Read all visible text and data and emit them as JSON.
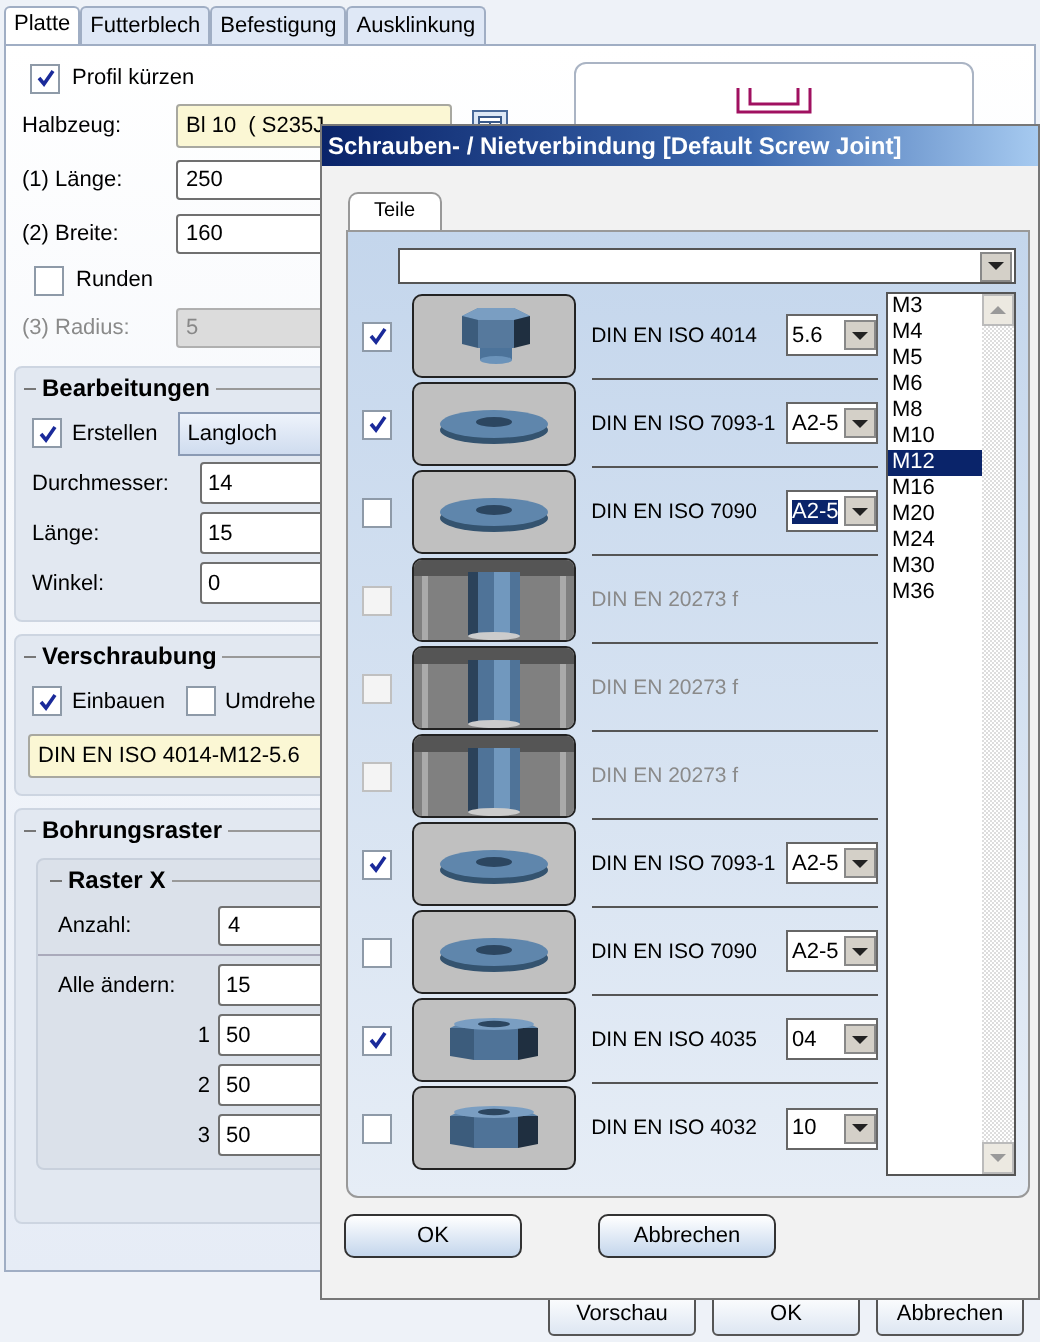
{
  "tabs": [
    {
      "label": "Platte",
      "selected": true
    },
    {
      "label": "Futterblech",
      "selected": false
    },
    {
      "label": "Befestigung",
      "selected": false
    },
    {
      "label": "Ausklinkung",
      "selected": false
    }
  ],
  "profil_kuerzen": {
    "label": "Profil kürzen",
    "checked": true
  },
  "halbzeug": {
    "label": "Halbzeug:",
    "value": "Bl 10  ( S235J"
  },
  "dims": [
    {
      "label": "(1) Länge:",
      "value": "250"
    },
    {
      "label": "(2) Breite:",
      "value": "160"
    }
  ],
  "runden": {
    "label": "Runden",
    "checked": false
  },
  "radius": {
    "label": "(3) Radius:",
    "value": "5",
    "disabled": true
  },
  "bearbeitungen": {
    "title": "Bearbeitungen",
    "erstellen": {
      "label": "Erstellen",
      "checked": true
    },
    "type": "Langloch",
    "fields": [
      {
        "label": "Durchmesser:",
        "value": "14"
      },
      {
        "label": "Länge:",
        "value": "15"
      },
      {
        "label": "Winkel:",
        "value": "0"
      }
    ]
  },
  "verschraubung": {
    "title": "Verschraubung",
    "checks": [
      {
        "label": "Einbauen",
        "checked": true
      },
      {
        "label": "Umdrehe",
        "checked": false
      }
    ],
    "description": "DIN EN ISO 4014-M12-5.6"
  },
  "bohrungsraster": {
    "title": "Bohrungsraster",
    "raster_x": {
      "title": "Raster X",
      "anzahl": {
        "label": "Anzahl:",
        "value": "4"
      },
      "alle": {
        "label": "Alle ändern:",
        "value": "15"
      },
      "items": [
        {
          "label": "1",
          "value": "50"
        },
        {
          "label": "2",
          "value": "50"
        },
        {
          "label": "3",
          "value": "50"
        }
      ]
    }
  },
  "buttons": [
    "Vorschau",
    "OK",
    "Abbrechen"
  ],
  "dialog": {
    "title": "Schrauben- / Nietverbindung [Default Screw Joint]",
    "tabs": [
      {
        "label": "Teile",
        "selected": true
      }
    ],
    "parts": [
      {
        "kind": "bolt",
        "checked": true,
        "disabled": false,
        "label": "DIN EN ISO 4014",
        "grade": "5.6",
        "grade_highlighted": false
      },
      {
        "kind": "washer",
        "checked": true,
        "disabled": false,
        "label": "DIN EN ISO 7093-1",
        "grade": "A2-5",
        "grade_highlighted": false
      },
      {
        "kind": "washer",
        "checked": false,
        "disabled": false,
        "label": "DIN EN ISO 7090",
        "grade": "A2-5",
        "grade_highlighted": true
      },
      {
        "kind": "hole",
        "checked": false,
        "disabled": true,
        "label": "DIN EN 20273 f"
      },
      {
        "kind": "hole",
        "checked": false,
        "disabled": true,
        "label": "DIN EN 20273 f"
      },
      {
        "kind": "hole",
        "checked": false,
        "disabled": true,
        "label": "DIN EN 20273 f"
      },
      {
        "kind": "washer",
        "checked": true,
        "disabled": false,
        "label": "DIN EN ISO 7093-1",
        "grade": "A2-5",
        "grade_highlighted": false
      },
      {
        "kind": "washer",
        "checked": false,
        "disabled": false,
        "label": "DIN EN ISO 7090",
        "grade": "A2-5",
        "grade_highlighted": false
      },
      {
        "kind": "nut",
        "checked": true,
        "disabled": false,
        "label": "DIN EN ISO 4035",
        "grade": "04",
        "grade_highlighted": false
      },
      {
        "kind": "nut",
        "checked": false,
        "disabled": false,
        "label": "DIN EN ISO 4032",
        "grade": "10",
        "grade_highlighted": false
      }
    ],
    "sizes": [
      {
        "label": "M3",
        "selected": false
      },
      {
        "label": "M4",
        "selected": false
      },
      {
        "label": "M5",
        "selected": false
      },
      {
        "label": "M6",
        "selected": false
      },
      {
        "label": "M8",
        "selected": false
      },
      {
        "label": "M10",
        "selected": false
      },
      {
        "label": "M12",
        "selected": true
      },
      {
        "label": "M16",
        "selected": false
      },
      {
        "label": "M20",
        "selected": false
      },
      {
        "label": "M24",
        "selected": false
      },
      {
        "label": "M30",
        "selected": false
      },
      {
        "label": "M36",
        "selected": false
      }
    ],
    "buttons": [
      "OK",
      "Abbrechen"
    ]
  }
}
